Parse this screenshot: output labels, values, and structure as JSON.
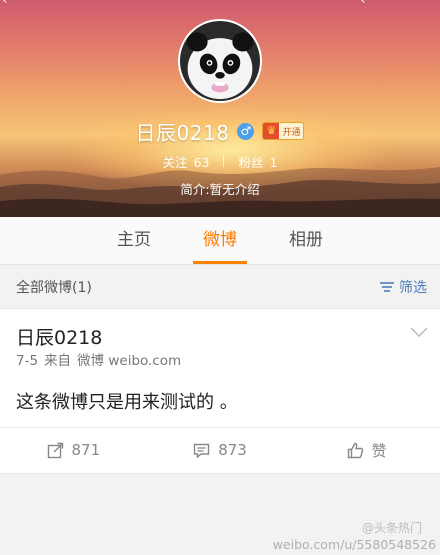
{
  "profile": {
    "name": "日辰0218",
    "gender_symbol": "♂",
    "vip_label": "开通",
    "follow_label": "关注",
    "follow_count": "63",
    "fans_label": "粉丝",
    "fans_count": "1",
    "intro": "简介:暂无介绍"
  },
  "tabs": [
    {
      "label": "主页",
      "active": false
    },
    {
      "label": "微博",
      "active": true
    },
    {
      "label": "相册",
      "active": false
    }
  ],
  "filter": {
    "all_label": "全部微博(1)",
    "filter_label": "筛选"
  },
  "post": {
    "user": "日辰0218",
    "date": "7-5",
    "source_prefix": "来自",
    "source": "微博 weibo.com",
    "text": "这条微博只是用来测试的 。",
    "repost_count": "871",
    "comment_count": "873",
    "like_label": "赞"
  },
  "watermark": {
    "line1": "@头条热门",
    "line2": "weibo.com/u/5580548526"
  },
  "colors": {
    "accent": "#ff8200",
    "link": "#4b7fbf",
    "gender": "#4da0ea"
  },
  "icons": [
    "settings-icon",
    "gender-male-icon",
    "vip-crown-icon",
    "filter-icon",
    "chevron-down-icon",
    "repost-icon",
    "comment-icon",
    "like-icon"
  ]
}
